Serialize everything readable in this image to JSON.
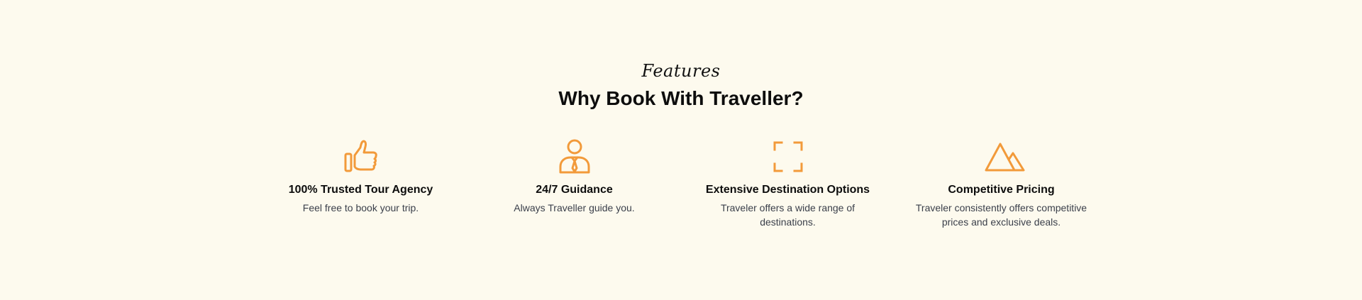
{
  "section": {
    "eyebrow": "Features",
    "title": "Why Book With Traveller?"
  },
  "accent_color": "#f29a3a",
  "features": [
    {
      "icon": "thumbs-up-icon",
      "title": "100% Trusted Tour Agency",
      "text": "Feel free to book your trip."
    },
    {
      "icon": "person-tie-icon",
      "title": "24/7 Guidance",
      "text": "Always Traveller guide you."
    },
    {
      "icon": "frame-corners-icon",
      "title": "Extensive Destination Options",
      "text": "Traveler offers a wide range of destinations."
    },
    {
      "icon": "mountains-icon",
      "title": "Competitive Pricing",
      "text": "Traveler consistently offers competitive prices and exclusive deals."
    }
  ]
}
